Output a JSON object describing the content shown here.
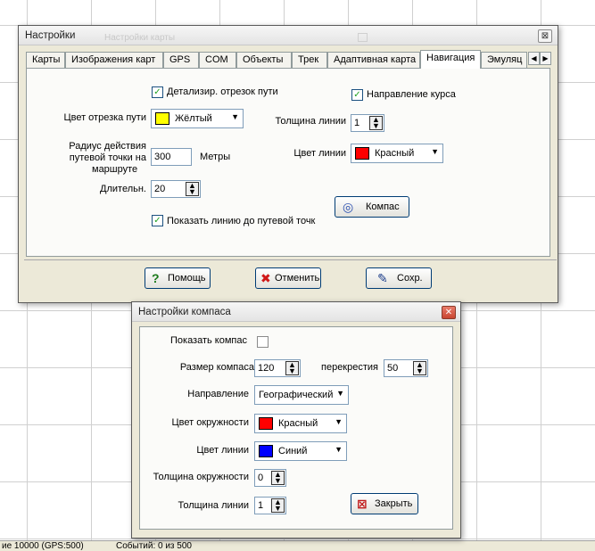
{
  "settings": {
    "title": "Настройки",
    "ghost_title": "Настройки карты",
    "close_glyph": "⊠",
    "tabs": [
      "Карты",
      "Изображения карт",
      "GPS",
      "COM",
      "Объекты",
      "Трек",
      "Адаптивная карта",
      "Навигация",
      "Эмуляц"
    ],
    "active_tab": "Навигация",
    "nav": {
      "segment_detail_label": "Детализир. отрезок пути",
      "segment_detail_checked": true,
      "course_direction_label": "Направление курса",
      "course_direction_checked": true,
      "segment_color_label": "Цвет отрезка пути",
      "segment_color_value": "Жёлтый",
      "segment_color_hex": "#ffff00",
      "line_width_label": "Толщина линии",
      "line_width_value": "1",
      "radius_label_1": "Радиус действия",
      "radius_label_2": "путевой точки на",
      "radius_label_3": "маршруте",
      "radius_value": "300",
      "radius_unit": "Метры",
      "line_color_label": "Цвет линии",
      "line_color_value": "Красный",
      "line_color_hex": "#ff0000",
      "duration_label": "Длительн.",
      "duration_value": "20",
      "compass_button": "Компас",
      "show_line_label": "Показать линию до путевой точк",
      "show_line_checked": true
    },
    "buttons": {
      "help": "Помощь",
      "cancel": "Отменить",
      "save": "Сохр."
    }
  },
  "compass": {
    "title": "Настройки компаса",
    "close_glyph": "✕",
    "show_compass_label": "Показать компас",
    "show_compass_checked": false,
    "size_label": "Размер компаса",
    "size_value": "120",
    "crosshair_label": "перекрестия",
    "crosshair_value": "50",
    "direction_label": "Направление",
    "direction_value": "Географический",
    "circle_color_label": "Цвет окружности",
    "circle_color_value": "Красный",
    "circle_color_hex": "#ff0000",
    "line_color_label": "Цвет линии",
    "line_color_value": "Синий",
    "line_color_hex": "#0000ff",
    "circle_width_label": "Толщина окружности",
    "circle_width_value": "0",
    "line_width_label": "Толщина линии",
    "line_width_value": "1",
    "close_button": "Закрыть"
  },
  "status_bar": {
    "left": "ие 10000 (GPS:500)",
    "right": "Событий: 0 из 500"
  },
  "icons": {
    "help": "question-icon",
    "cancel": "red-x-icon",
    "save": "save-check-icon",
    "compass": "compass-icon",
    "close": "close-icon"
  }
}
